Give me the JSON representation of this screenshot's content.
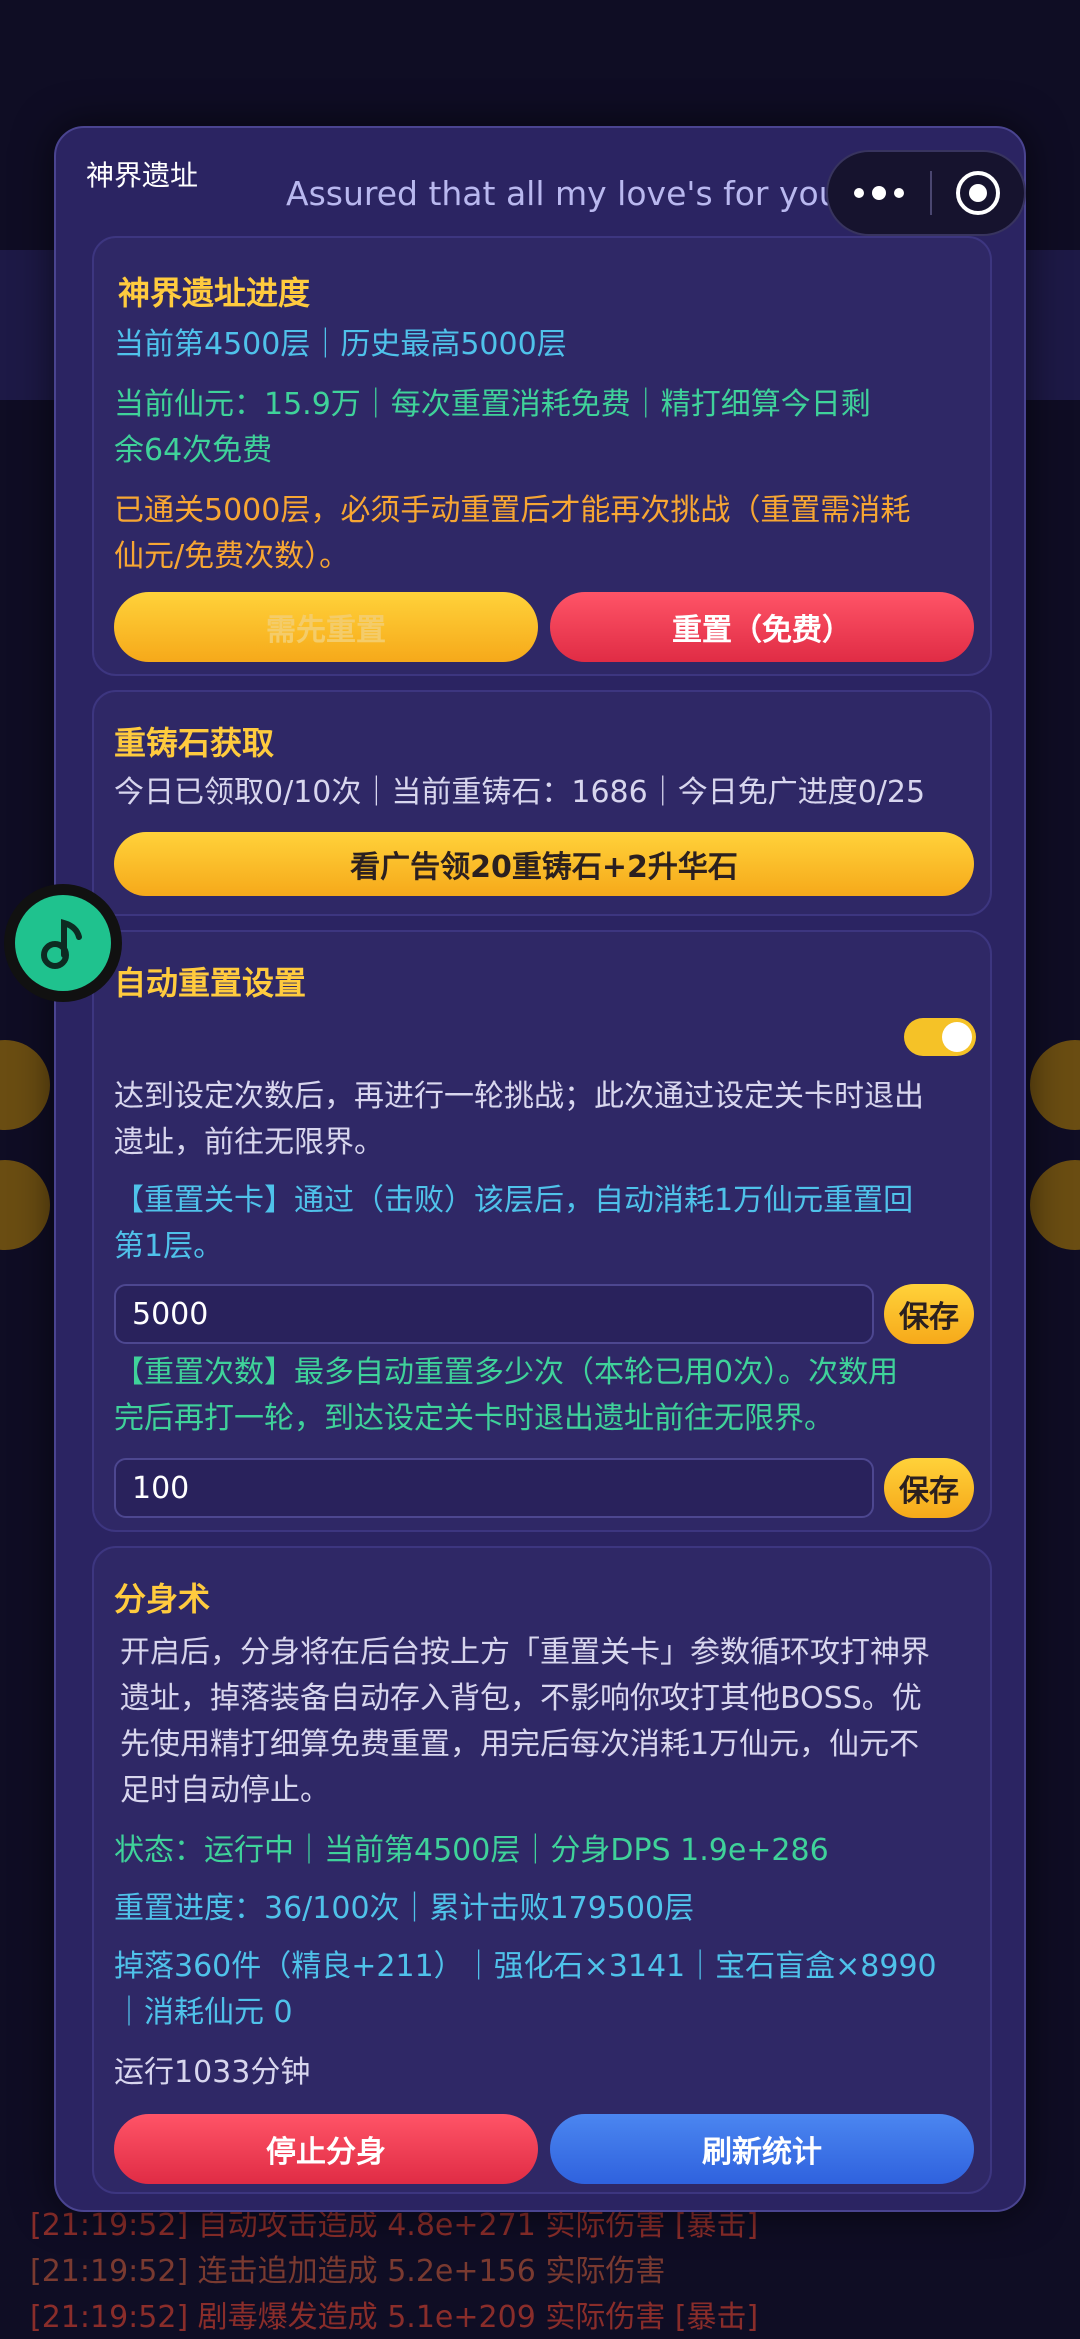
{
  "modal": {
    "title": "神界遗址",
    "marquee": "Assured that all my love's for you",
    "close": "×"
  },
  "progress": {
    "title": "神界遗址进度",
    "floor_line": "当前第4500层｜历史最高5000层",
    "currency_line_1": "当前仙元：15.9万｜每次重置消耗免费｜精打细算今日剩",
    "currency_line_2": "余64次免费",
    "warn_line_1": "已通关5000层，必须手动重置后才能再次挑战（重置需消耗",
    "warn_line_2": "仙元/免费次数）。",
    "btn_need_reset": "需先重置",
    "btn_reset": "重置（免费）"
  },
  "stone": {
    "title": "重铸石获取",
    "info": "今日已领取0/10次｜当前重铸石：1686｜今日免广进度0/25",
    "btn_ad": "看广告领20重铸石+2升华石"
  },
  "auto": {
    "title": "自动重置设置",
    "desc_1": "达到设定次数后，再进行一轮挑战；此次通过设定关卡时退出",
    "desc_2": "遗址，前往无限界。",
    "stage_desc_1": "【重置关卡】通过（击败）该层后，自动消耗1万仙元重置回",
    "stage_desc_2": "第1层。",
    "stage_value": "5000",
    "count_desc_1": "【重置次数】最多自动重置多少次（本轮已用0次）。次数用",
    "count_desc_2": "完后再打一轮，到达设定关卡时退出遗址前往无限界。",
    "count_value": "100",
    "save_label": "保存",
    "toggle_on": true
  },
  "clone": {
    "title": "分身术",
    "desc_1": "开启后，分身将在后台按上方「重置关卡」参数循环攻打神界",
    "desc_2": "遗址，掉落装备自动存入背包，不影响你攻打其他BOSS。优",
    "desc_3": "先使用精打细算免费重置，用完后每次消耗1万仙元，仙元不",
    "desc_4": "足时自动停止。",
    "status": "状态：运行中｜当前第4500层｜分身DPS 1.9e+286",
    "reset_progress": "重置进度：36/100次｜累计击败179500层",
    "drops_1": "掉落360件（精良+211）｜强化石×3141｜宝石盲盒×8990",
    "drops_2": "｜消耗仙元 0",
    "runtime": "运行1033分钟",
    "btn_stop": "停止分身",
    "btn_refresh": "刷新统计"
  },
  "background_log": {
    "line_1": "[21:19:52] 自动攻击造成 4.8e+271 实际伤害 [暴击]",
    "line_2": "[21:19:52] 连击追加造成 5.2e+156 实际伤害",
    "line_3": "[21:19:52] 剧毒爆发造成 5.1e+209 实际伤害 [暴击]"
  },
  "colors": {
    "accent_yellow": "#ffcb3e",
    "cyan": "#4fc2ea",
    "green": "#3fd29a",
    "orange": "#f7a633",
    "modal_bg": "#2b2462"
  },
  "icons": {
    "capsule_menu": "more-dots-icon",
    "capsule_close": "target-circle-icon",
    "fab": "music-note-icon"
  }
}
